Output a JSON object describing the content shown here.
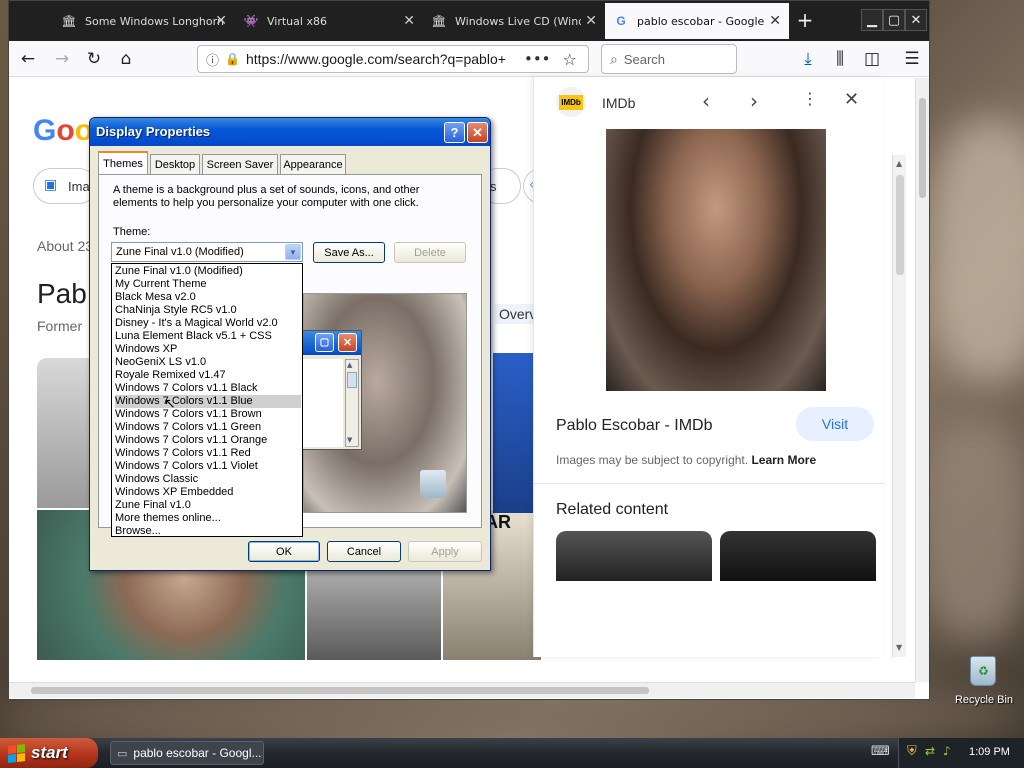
{
  "browser": {
    "tabs": [
      {
        "title": "Some Windows Longhorn",
        "icon": "museum-icon"
      },
      {
        "title": "Virtual x86",
        "icon": "invader-icon"
      },
      {
        "title": "Windows Live CD (Windo",
        "icon": "museum-icon"
      },
      {
        "title": "pablo escobar - Google Se",
        "icon": "google-icon"
      }
    ],
    "new_tab": "+",
    "url": "https://www.google.com/search?q=pablo+e",
    "search_placeholder": "Search"
  },
  "google": {
    "logo": "Google",
    "chip_image": "Ima",
    "about": "About 23",
    "title_partial": "Pab",
    "subtitle_partial": "Former",
    "chip_s": "s",
    "overview_tab": "Overvie"
  },
  "knowledge_panel": {
    "source": "IMDb",
    "source_badge": "IMDb",
    "title": "Pablo Escobar - IMDb",
    "visit": "Visit",
    "copyright": "Images may be subject to copyright.",
    "learn_more": "Learn More",
    "related": "Related content"
  },
  "dialog": {
    "title": "Display Properties",
    "help": "?",
    "close": "✕",
    "tabs": [
      "Themes",
      "Desktop",
      "Screen Saver",
      "Appearance"
    ],
    "description": "A theme is a background plus a set of sounds, icons, and other elements to help you personalize your computer with one click.",
    "theme_label": "Theme:",
    "selected_theme": "Zune Final v1.0 (Modified)",
    "save_as": "Save As...",
    "delete": "Delete",
    "ok": "OK",
    "cancel": "Cancel",
    "apply": "Apply",
    "theme_options": [
      "Zune Final v1.0 (Modified)",
      "My Current Theme",
      "Black Mesa v2.0",
      "ChaNinja Style RC5 v1.0",
      "Disney - It's a Magical World v2.0",
      "Luna Element Black v5.1 + CSS",
      "Windows XP",
      "NeoGeniX LS v1.0",
      "Royale Remixed v1.47",
      "Windows 7 Colors v1.1 Black",
      "Windows 7 Colors v1.1 Blue",
      "Windows 7 Colors v1.1 Brown",
      "Windows 7 Colors v1.1 Green",
      "Windows 7 Colors v1.1 Orange",
      "Windows 7 Colors v1.1 Red",
      "Windows 7 Colors v1.1 Violet",
      "Windows Classic",
      "Windows XP Embedded",
      "Zune Final v1.0",
      "More themes online...",
      "Browse..."
    ],
    "highlighted_index": 10
  },
  "newspaper_text": "COBAR",
  "desktop": {
    "recycle_bin": "Recycle Bin"
  },
  "taskbar": {
    "start": "start",
    "task_item": "pablo escobar - Googl...",
    "clock": "1:09 PM"
  }
}
